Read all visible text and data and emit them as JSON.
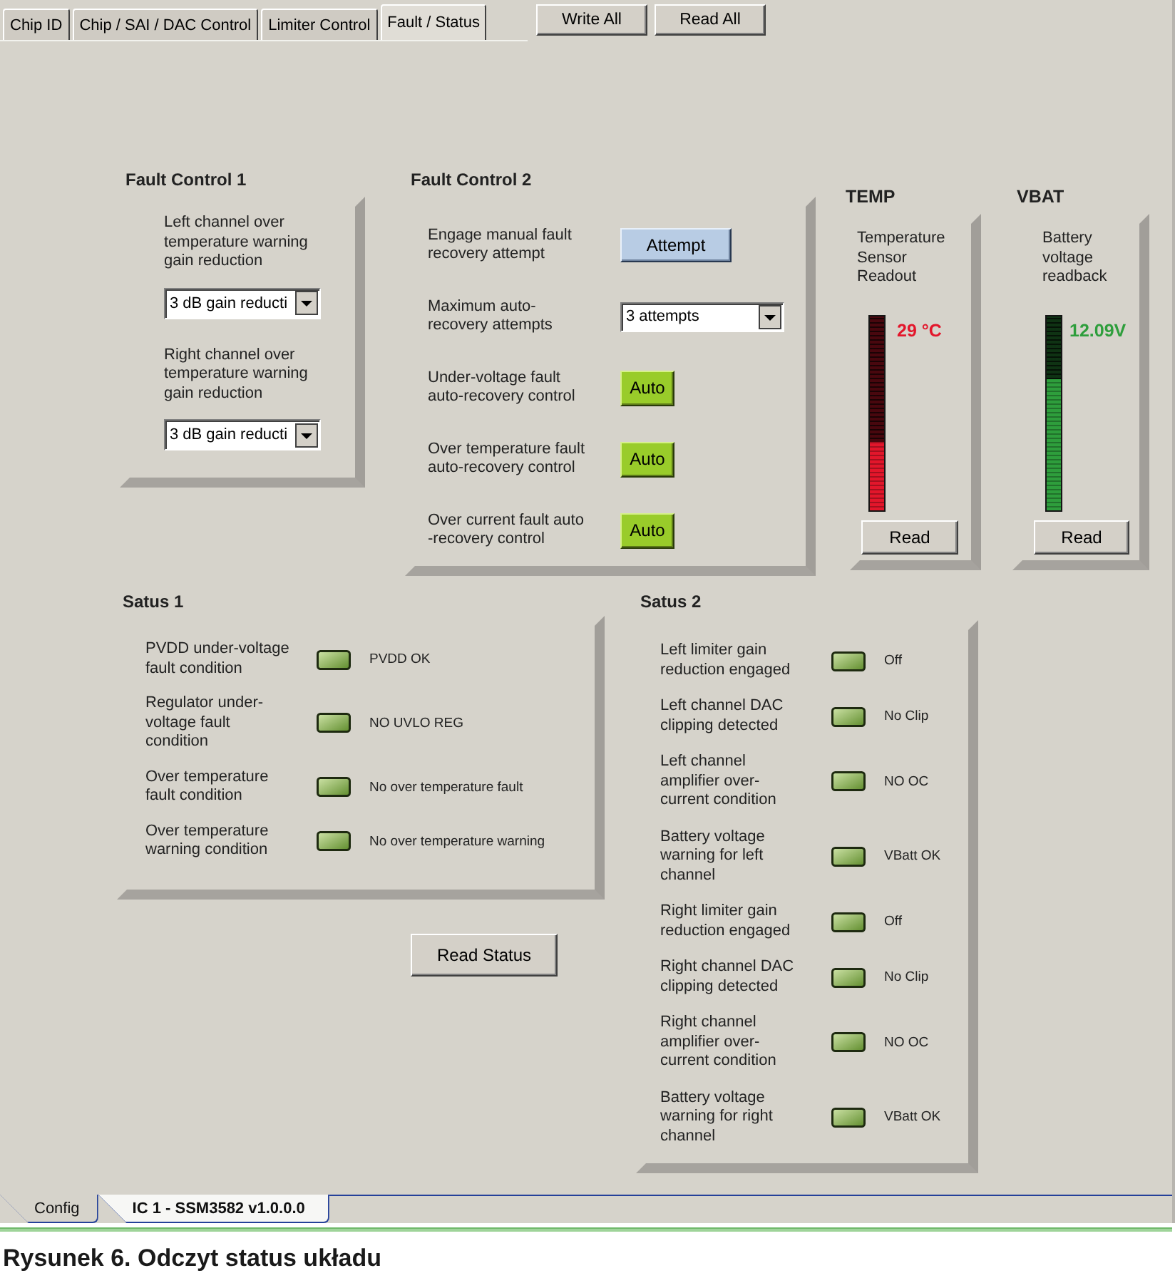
{
  "tabs": [
    {
      "label": "Chip ID",
      "selected": false
    },
    {
      "label": "Chip / SAI / DAC Control",
      "selected": false
    },
    {
      "label": "Limiter Control",
      "selected": false
    },
    {
      "label": "Fault / Status",
      "selected": true
    }
  ],
  "toolbar_buttons": [
    "Write All",
    "Read All"
  ],
  "fault_control_1": {
    "title": "Fault Control 1",
    "items": [
      {
        "label": "Left channel over\ntemperature warning\ngain reduction",
        "value": "3 dB gain reducti"
      },
      {
        "label": "Right channel over\ntemperature warning\ngain reduction",
        "value": "3 dB gain reducti"
      }
    ]
  },
  "fault_control_2": {
    "title": "Fault Control 2",
    "items": [
      {
        "kind": "button",
        "label": "Engage manual fault\nrecovery attempt",
        "value": "Attempt"
      },
      {
        "kind": "select",
        "label": "Maximum auto-\nrecovery attempts",
        "value": "3 attempts"
      },
      {
        "kind": "toggle",
        "label": "Under-voltage fault\nauto-recovery control",
        "value": "Auto",
        "on": true
      },
      {
        "kind": "toggle",
        "label": "Over temperature fault\nauto-recovery control",
        "value": "Auto",
        "on": true
      },
      {
        "kind": "toggle",
        "label": "Over current fault auto\n-recovery control",
        "value": "Auto",
        "on": true
      }
    ]
  },
  "meters": [
    {
      "title": "TEMP",
      "label": "Temperature\nSensor\nReadout",
      "level": 0.35,
      "reading": "29 °C",
      "color": "#e3162b",
      "button": "Read"
    },
    {
      "title": "VBAT",
      "label": "Battery\nvoltage\nreadback",
      "level": 0.67,
      "reading": "12.09V",
      "color": "#2e9e3c",
      "button": "Read"
    }
  ],
  "status_1": {
    "title": "Satus 1",
    "items": [
      {
        "label": "PVDD under-voltage\nfault condition",
        "value": "PVDD OK"
      },
      {
        "label": "Regulator under-\nvoltage fault\ncondition",
        "value": "NO UVLO REG"
      },
      {
        "label": "Over temperature\nfault condition",
        "value": "No over temperature fault"
      },
      {
        "label": "Over temperature\nwarning condition",
        "value": "No over temperature warning"
      }
    ]
  },
  "read_status_button": "Read Status",
  "status_2": {
    "title": "Satus 2",
    "items": [
      {
        "label": "Left limiter gain\nreduction engaged",
        "value": "Off"
      },
      {
        "label": "Left channel DAC\nclipping detected",
        "value": "No Clip"
      },
      {
        "label": "Left channel\namplifier over-\ncurrent condition",
        "value": "NO OC"
      },
      {
        "label": "Battery voltage\nwarning for left\nchannel",
        "value": "VBatt OK"
      },
      {
        "label": "Right limiter gain\nreduction engaged",
        "value": "Off"
      },
      {
        "label": "Right channel DAC\nclipping detected",
        "value": "No Clip"
      },
      {
        "label": "Right channel\namplifier over-\ncurrent condition",
        "value": "NO OC"
      },
      {
        "label": "Battery voltage\nwarning for right\nchannel",
        "value": "VBatt OK"
      }
    ]
  },
  "bottom_tabs": [
    {
      "label": "Config",
      "selected": false
    },
    {
      "label": "IC 1 - SSM3582 v1.0.0.0",
      "selected": true
    }
  ],
  "caption": "Rysunek 6. Odczyt status układu"
}
